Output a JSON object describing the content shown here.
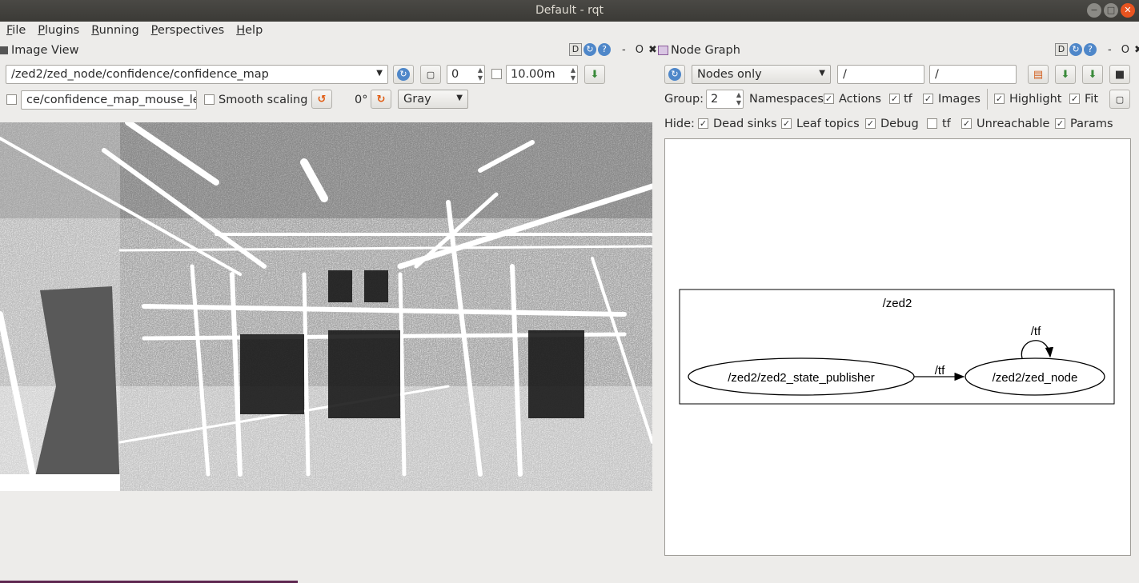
{
  "window": {
    "title": "Default - rqt"
  },
  "menu": [
    {
      "prefix": "",
      "mnemonic": "F",
      "rest": "ile"
    },
    {
      "prefix": "",
      "mnemonic": "P",
      "rest": "lugins"
    },
    {
      "prefix": "",
      "mnemonic": "R",
      "rest": "unning"
    },
    {
      "prefix": "",
      "mnemonic": "P",
      "rest": "erspectives"
    },
    {
      "prefix": "",
      "mnemonic": "H",
      "rest": "elp"
    }
  ],
  "dock_controls": {
    "d": "D",
    "minus": "-",
    "o": "O",
    "close": "✖"
  },
  "image_view": {
    "title": "Image View",
    "topic": "/zed2/zed_node/confidence/confidence_map",
    "spin_value": "0",
    "max_range": "10.00m",
    "mouse_topic": "ce/confidence_map_mouse_left",
    "smooth_scaling_label": "Smooth scaling",
    "rotation": "0°",
    "colormap": "Gray"
  },
  "node_graph": {
    "title": "Node Graph",
    "mode": "Nodes only",
    "filter1": "/",
    "filter2": "/",
    "group_label": "Group:",
    "group_value": "2",
    "namespaces_label": "Namespaces",
    "actions_label": "Actions",
    "tf_label": "tf",
    "images_label": "Images",
    "highlight_label": "Highlight",
    "fit_label": "Fit",
    "hide_label": "Hide:",
    "dead_sinks_label": "Dead sinks",
    "leaf_topics_label": "Leaf topics",
    "debug_label": "Debug",
    "hide_tf_label": "tf",
    "unreachable_label": "Unreachable",
    "params_label": "Params",
    "graph": {
      "cluster": "/zed2",
      "node1": "/zed2/zed2_state_publisher",
      "node2": "/zed2/zed_node",
      "edge_label": "/tf",
      "self_loop_label": "/tf"
    }
  },
  "colors": {
    "background": "#edecea",
    "titlebar": "#3b3a36",
    "accent": "#e95420",
    "refresh": "#4f87c9"
  }
}
